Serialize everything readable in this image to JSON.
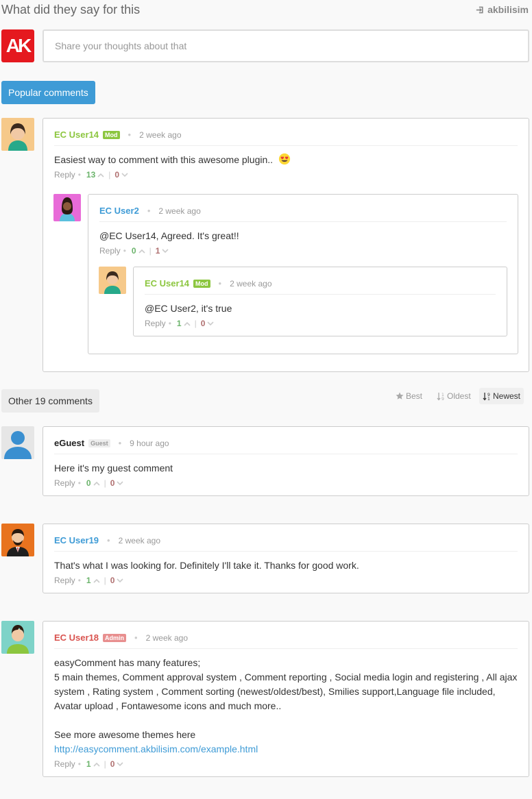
{
  "header": {
    "title": "What did they say for this",
    "login_label": "akbilisim"
  },
  "composer": {
    "logo_text": "AK",
    "placeholder": "Share your thoughts about that"
  },
  "popular": {
    "button_label": "Popular comments",
    "comments": [
      {
        "author": "EC User14",
        "badge": "Mod",
        "time": "2 week ago",
        "text": "Easiest way to comment with this awesome plugin..",
        "reply_label": "Reply",
        "up": "13",
        "down": "0",
        "replies": [
          {
            "author": "EC User2",
            "time": "2 week ago",
            "text": "@EC User14, Agreed. It's great!!",
            "reply_label": "Reply",
            "up": "0",
            "down": "1",
            "replies": [
              {
                "author": "EC User14",
                "badge": "Mod",
                "time": "2 week ago",
                "text": "@EC User2, it's true",
                "reply_label": "Reply",
                "up": "1",
                "down": "0"
              }
            ]
          }
        ]
      }
    ]
  },
  "other": {
    "label": "Other 19 comments",
    "sort": {
      "best": "Best",
      "oldest": "Oldest",
      "newest": "Newest",
      "active": "newest"
    },
    "comments": [
      {
        "author": "eGuest",
        "badge": "Guest",
        "time": "9 hour ago",
        "text": "Here it's my guest comment",
        "reply_label": "Reply",
        "up": "0",
        "down": "0"
      },
      {
        "author": "EC User19",
        "time": "2 week ago",
        "text": "That's what I was looking for. Definitely I'll take it. Thanks for good work.",
        "reply_label": "Reply",
        "up": "1",
        "down": "0"
      },
      {
        "author": "EC User18",
        "badge": "Admin",
        "time": "2 week ago",
        "text_lines": [
          "easyComment has many features;",
          "5 main themes, Comment approval system , Comment reporting , Social media login and registering , All ajax system , Rating system , Comment sorting (newest/oldest/best), Smilies support,Language file included, Avatar upload , Fontawesome icons and much more..",
          "See more awesome themes here"
        ],
        "link": "http://easycomment.akbilisim.com/example.html",
        "reply_label": "Reply",
        "up": "1",
        "down": "0"
      }
    ]
  },
  "colors": {
    "accent": "#3e9bd6",
    "mod_badge": "#8cc63f",
    "admin_badge": "#e88f8f",
    "logo_red": "#e5191f"
  }
}
